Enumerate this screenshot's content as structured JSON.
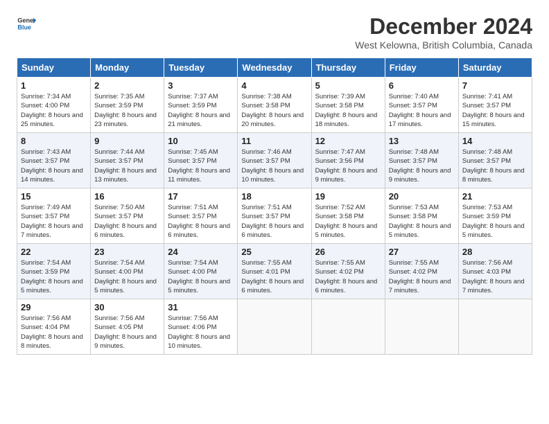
{
  "header": {
    "logo_line1": "General",
    "logo_line2": "Blue",
    "month": "December 2024",
    "location": "West Kelowna, British Columbia, Canada"
  },
  "days_of_week": [
    "Sunday",
    "Monday",
    "Tuesday",
    "Wednesday",
    "Thursday",
    "Friday",
    "Saturday"
  ],
  "weeks": [
    [
      {
        "day": "1",
        "sunrise": "7:34 AM",
        "sunset": "4:00 PM",
        "daylight": "8 hours and 25 minutes."
      },
      {
        "day": "2",
        "sunrise": "7:35 AM",
        "sunset": "3:59 PM",
        "daylight": "8 hours and 23 minutes."
      },
      {
        "day": "3",
        "sunrise": "7:37 AM",
        "sunset": "3:59 PM",
        "daylight": "8 hours and 21 minutes."
      },
      {
        "day": "4",
        "sunrise": "7:38 AM",
        "sunset": "3:58 PM",
        "daylight": "8 hours and 20 minutes."
      },
      {
        "day": "5",
        "sunrise": "7:39 AM",
        "sunset": "3:58 PM",
        "daylight": "8 hours and 18 minutes."
      },
      {
        "day": "6",
        "sunrise": "7:40 AM",
        "sunset": "3:57 PM",
        "daylight": "8 hours and 17 minutes."
      },
      {
        "day": "7",
        "sunrise": "7:41 AM",
        "sunset": "3:57 PM",
        "daylight": "8 hours and 15 minutes."
      }
    ],
    [
      {
        "day": "8",
        "sunrise": "7:43 AM",
        "sunset": "3:57 PM",
        "daylight": "8 hours and 14 minutes."
      },
      {
        "day": "9",
        "sunrise": "7:44 AM",
        "sunset": "3:57 PM",
        "daylight": "8 hours and 13 minutes."
      },
      {
        "day": "10",
        "sunrise": "7:45 AM",
        "sunset": "3:57 PM",
        "daylight": "8 hours and 11 minutes."
      },
      {
        "day": "11",
        "sunrise": "7:46 AM",
        "sunset": "3:57 PM",
        "daylight": "8 hours and 10 minutes."
      },
      {
        "day": "12",
        "sunrise": "7:47 AM",
        "sunset": "3:56 PM",
        "daylight": "8 hours and 9 minutes."
      },
      {
        "day": "13",
        "sunrise": "7:48 AM",
        "sunset": "3:57 PM",
        "daylight": "8 hours and 9 minutes."
      },
      {
        "day": "14",
        "sunrise": "7:48 AM",
        "sunset": "3:57 PM",
        "daylight": "8 hours and 8 minutes."
      }
    ],
    [
      {
        "day": "15",
        "sunrise": "7:49 AM",
        "sunset": "3:57 PM",
        "daylight": "8 hours and 7 minutes."
      },
      {
        "day": "16",
        "sunrise": "7:50 AM",
        "sunset": "3:57 PM",
        "daylight": "8 hours and 6 minutes."
      },
      {
        "day": "17",
        "sunrise": "7:51 AM",
        "sunset": "3:57 PM",
        "daylight": "8 hours and 6 minutes."
      },
      {
        "day": "18",
        "sunrise": "7:51 AM",
        "sunset": "3:57 PM",
        "daylight": "8 hours and 6 minutes."
      },
      {
        "day": "19",
        "sunrise": "7:52 AM",
        "sunset": "3:58 PM",
        "daylight": "8 hours and 5 minutes."
      },
      {
        "day": "20",
        "sunrise": "7:53 AM",
        "sunset": "3:58 PM",
        "daylight": "8 hours and 5 minutes."
      },
      {
        "day": "21",
        "sunrise": "7:53 AM",
        "sunset": "3:59 PM",
        "daylight": "8 hours and 5 minutes."
      }
    ],
    [
      {
        "day": "22",
        "sunrise": "7:54 AM",
        "sunset": "3:59 PM",
        "daylight": "8 hours and 5 minutes."
      },
      {
        "day": "23",
        "sunrise": "7:54 AM",
        "sunset": "4:00 PM",
        "daylight": "8 hours and 5 minutes."
      },
      {
        "day": "24",
        "sunrise": "7:54 AM",
        "sunset": "4:00 PM",
        "daylight": "8 hours and 5 minutes."
      },
      {
        "day": "25",
        "sunrise": "7:55 AM",
        "sunset": "4:01 PM",
        "daylight": "8 hours and 6 minutes."
      },
      {
        "day": "26",
        "sunrise": "7:55 AM",
        "sunset": "4:02 PM",
        "daylight": "8 hours and 6 minutes."
      },
      {
        "day": "27",
        "sunrise": "7:55 AM",
        "sunset": "4:02 PM",
        "daylight": "8 hours and 7 minutes."
      },
      {
        "day": "28",
        "sunrise": "7:56 AM",
        "sunset": "4:03 PM",
        "daylight": "8 hours and 7 minutes."
      }
    ],
    [
      {
        "day": "29",
        "sunrise": "7:56 AM",
        "sunset": "4:04 PM",
        "daylight": "8 hours and 8 minutes."
      },
      {
        "day": "30",
        "sunrise": "7:56 AM",
        "sunset": "4:05 PM",
        "daylight": "8 hours and 9 minutes."
      },
      {
        "day": "31",
        "sunrise": "7:56 AM",
        "sunset": "4:06 PM",
        "daylight": "8 hours and 10 minutes."
      },
      null,
      null,
      null,
      null
    ]
  ]
}
